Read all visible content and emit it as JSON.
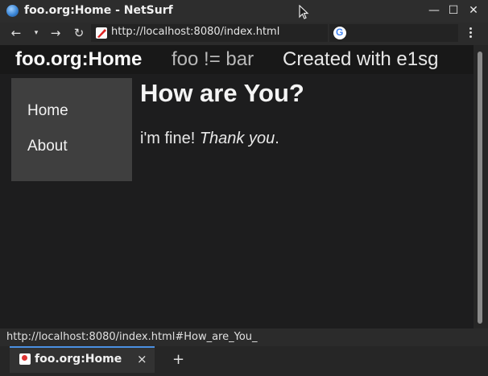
{
  "window": {
    "title": "foo.org:Home - NetSurf",
    "icon": "globe-icon",
    "minimize_glyph": "—",
    "maximize_glyph": "☐",
    "close_glyph": "✕"
  },
  "toolbar": {
    "back_glyph": "←",
    "history_glyph": "▾",
    "forward_glyph": "→",
    "reload_glyph": "↻",
    "url": "http://localhost:8080/index.html",
    "search_engine_icon": "google-icon",
    "search_engine_letter": "G",
    "menu_icon": "kebab-menu-icon"
  },
  "page": {
    "nav": {
      "brand": "foo.org:Home",
      "link1": "foo != bar",
      "link2": "Created with e1sg"
    },
    "sidebar": {
      "items": [
        {
          "label": "Home"
        },
        {
          "label": "About"
        }
      ]
    },
    "heading": "How are You?",
    "paragraph": {
      "prefix": "i'm fine! ",
      "emphasis": "Thank you",
      "suffix": "."
    }
  },
  "status": {
    "text": "http://localhost:8080/index.html#How_are_You_"
  },
  "tabs": [
    {
      "title": "foo.org:Home",
      "close_glyph": "×"
    }
  ],
  "new_tab_glyph": "+",
  "colors": {
    "page_background": "#1d1d1e",
    "sidebar_background": "#3f3f3f",
    "tab_accent": "#4a90e2"
  }
}
